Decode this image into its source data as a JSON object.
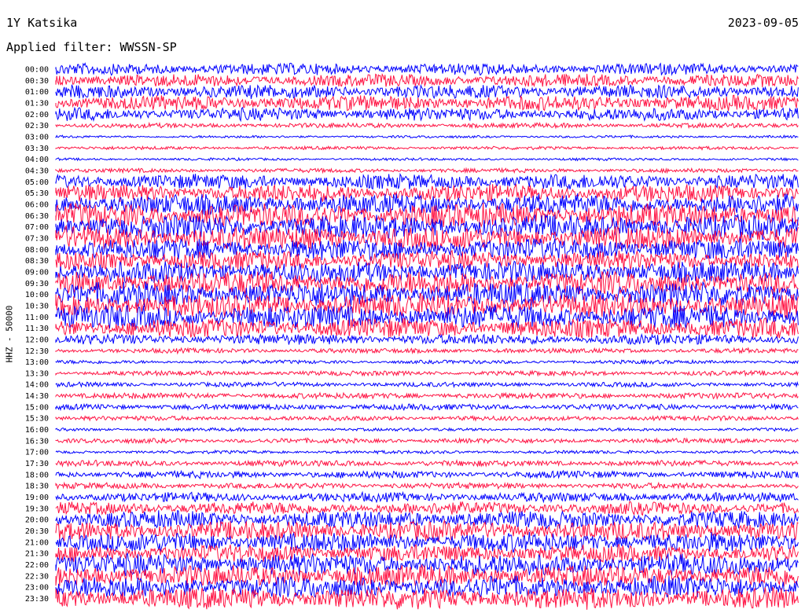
{
  "header": {
    "station": "1Y Katsika",
    "date": "2023-09-05",
    "filter_label": "Applied filter: WWSSN-SP"
  },
  "chart_data": {
    "type": "line",
    "title": "1Y Katsika",
    "ylabel": "HHZ - 50000",
    "colors": [
      "#0000ff",
      "#ff1444"
    ],
    "row_labels": [
      "00:00",
      "00:30",
      "01:00",
      "01:30",
      "02:00",
      "02:30",
      "03:00",
      "03:30",
      "04:00",
      "04:30",
      "05:00",
      "05:30",
      "06:00",
      "06:30",
      "07:00",
      "07:30",
      "08:00",
      "08:30",
      "09:00",
      "09:30",
      "10:00",
      "10:30",
      "11:00",
      "11:30",
      "12:00",
      "12:30",
      "13:00",
      "13:30",
      "14:00",
      "14:30",
      "15:00",
      "15:30",
      "16:00",
      "16:30",
      "17:00",
      "17:30",
      "18:00",
      "18:30",
      "19:00",
      "19:30",
      "20:00",
      "20:30",
      "21:00",
      "21:30",
      "22:00",
      "22:30",
      "23:00",
      "23:30"
    ],
    "amplitude_level": [
      0.45,
      0.5,
      0.55,
      0.6,
      0.5,
      0.15,
      0.05,
      0.08,
      0.05,
      0.12,
      0.6,
      0.7,
      0.85,
      1.0,
      1.0,
      1.0,
      0.9,
      0.8,
      0.9,
      1.0,
      1.0,
      1.0,
      1.0,
      0.8,
      0.4,
      0.15,
      0.1,
      0.15,
      0.15,
      0.2,
      0.2,
      0.15,
      0.08,
      0.15,
      0.08,
      0.2,
      0.25,
      0.2,
      0.35,
      0.5,
      0.7,
      0.8,
      0.8,
      0.7,
      0.9,
      0.9,
      0.9,
      0.9
    ]
  }
}
